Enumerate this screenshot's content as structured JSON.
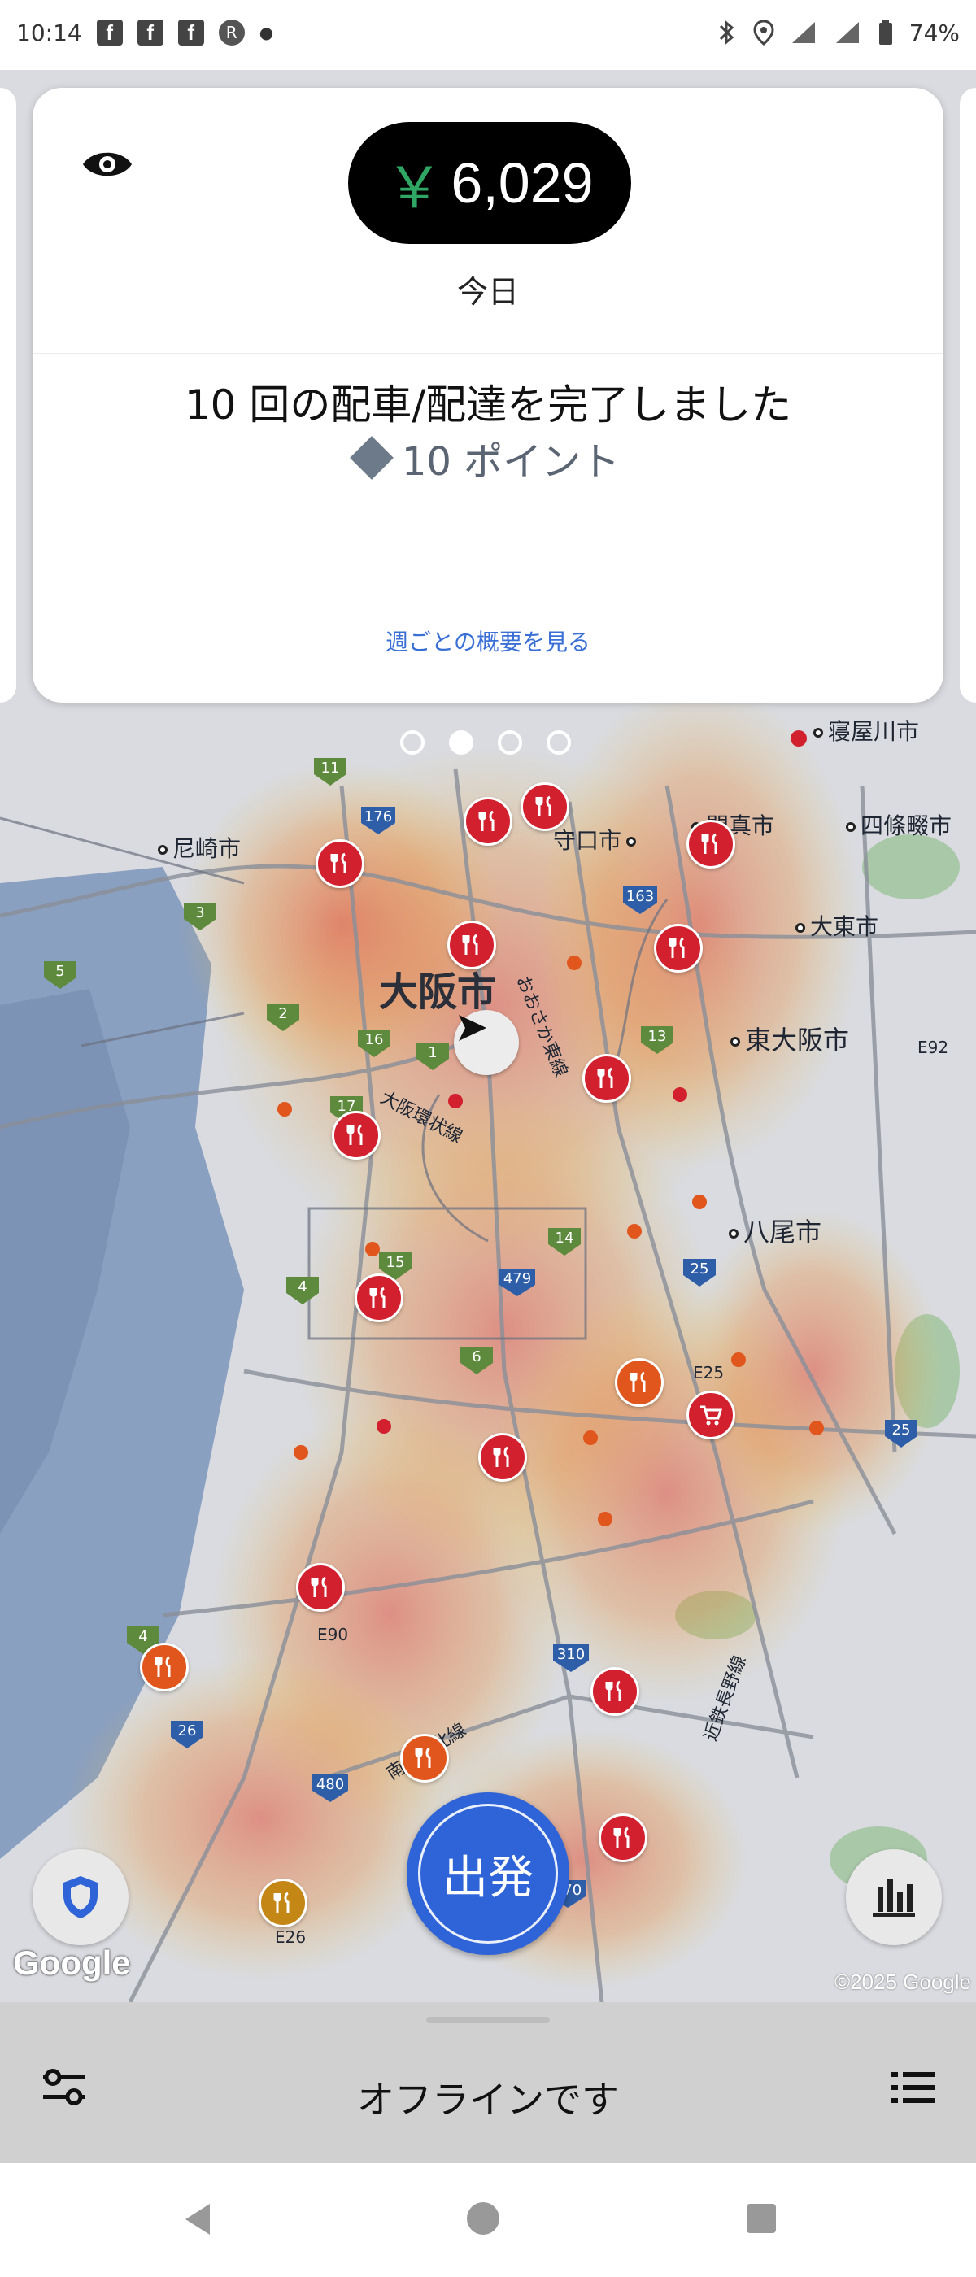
{
  "status_bar": {
    "time": "10:14",
    "battery": "74%",
    "left_icons": [
      "facebook-icon",
      "facebook-icon",
      "facebook-icon",
      "rakuten-icon",
      "notification-dot-icon"
    ],
    "right_icons": [
      "bluetooth-icon",
      "location-icon",
      "signal-icon",
      "signal-icon",
      "battery-icon"
    ]
  },
  "card": {
    "earnings_currency": "￥",
    "earnings_amount": "6,029",
    "period_label": "今日",
    "completed_text": "10 回の配車/配達を完了しました",
    "points_text": "10 ポイント",
    "weekly_link": "週ごとの概要を見る",
    "colors": {
      "currency": "#2fa664",
      "link": "#3a6fd6",
      "pill": "#000000"
    }
  },
  "carousel": {
    "count": 4,
    "active_index": 1
  },
  "map": {
    "city_labels": [
      {
        "name": "寝屋川市"
      },
      {
        "name": "尼崎市"
      },
      {
        "name": "守口市"
      },
      {
        "name": "門真市"
      },
      {
        "name": "四條畷市"
      },
      {
        "name": "大東市"
      },
      {
        "name": "大阪市"
      },
      {
        "name": "東大阪市"
      },
      {
        "name": "八尾市"
      },
      {
        "name": "おおさか東線"
      },
      {
        "name": "大阪環状線"
      },
      {
        "name": "南海泉北線"
      },
      {
        "name": "近鉄長野線"
      }
    ],
    "road_labels": [
      "E92",
      "E25",
      "E90",
      "E26",
      "E26"
    ],
    "route_shields": [
      "11",
      "176",
      "3",
      "163",
      "5",
      "2",
      "16",
      "1",
      "13",
      "17",
      "14",
      "15",
      "479",
      "4",
      "25",
      "6",
      "25",
      "26",
      "310",
      "480",
      "170",
      "4"
    ],
    "google_logo": "Google",
    "copyright": "©2025 Google"
  },
  "actions": {
    "go_label": "出発"
  },
  "bottom_sheet": {
    "status_text": "オフラインです"
  }
}
